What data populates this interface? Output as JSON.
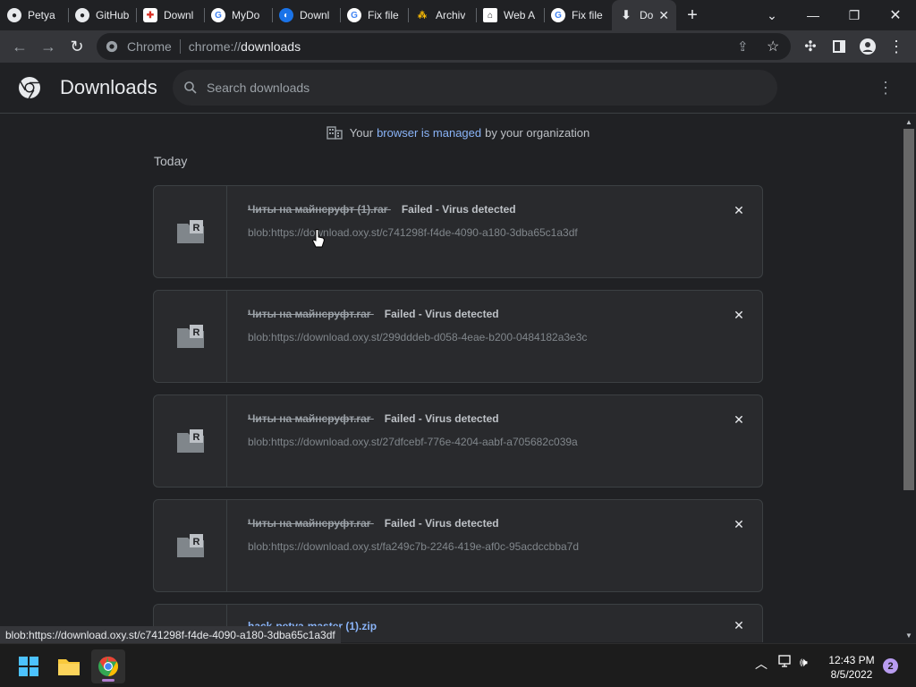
{
  "tabs": [
    {
      "label": "Petya",
      "icon": "github-icon",
      "active": false
    },
    {
      "label": "GitHub",
      "icon": "github-icon",
      "active": false
    },
    {
      "label": "Downl",
      "icon": "download-site-icon",
      "active": false
    },
    {
      "label": "MyDo",
      "icon": "google-icon",
      "active": false
    },
    {
      "label": "Downl",
      "icon": "download-site-icon",
      "active": false
    },
    {
      "label": "Fix file",
      "icon": "google-icon",
      "active": false
    },
    {
      "label": "Archiv",
      "icon": "archive-icon",
      "active": false
    },
    {
      "label": "Web A",
      "icon": "web-archive-icon",
      "active": false
    },
    {
      "label": "Fix file",
      "icon": "google-icon",
      "active": false
    },
    {
      "label": "Do",
      "icon": "download-icon",
      "active": true
    }
  ],
  "address": {
    "chip": "Chrome",
    "scheme": "chrome://",
    "host": "downloads"
  },
  "page": {
    "title": "Downloads",
    "search_placeholder": "Search downloads",
    "managed_prefix": "Your",
    "managed_link": "browser is managed",
    "managed_suffix": "by your organization",
    "section_today": "Today"
  },
  "downloads": [
    {
      "name": "Читы на майнсруфт (1).rar",
      "status": "Failed - Virus detected",
      "url": "blob:https://download.oxy.st/c741298f-f4de-4090-a180-3dba65c1a3df"
    },
    {
      "name": "Читы на майнсруфт.rar",
      "status": "Failed - Virus detected",
      "url": "blob:https://download.oxy.st/299dddeb-d058-4eae-b200-0484182a3e3c"
    },
    {
      "name": "Читы на майнсруфт.rar",
      "status": "Failed - Virus detected",
      "url": "blob:https://download.oxy.st/27dfcebf-776e-4204-aabf-a705682c039a"
    },
    {
      "name": "Читы на майнсруфт.rar",
      "status": "Failed - Virus detected",
      "url": "blob:https://download.oxy.st/fa249c7b-2246-419e-af0c-95acdccbba7d"
    },
    {
      "name": "hack-petya-master (1).zip"
    }
  ],
  "statusbar": {
    "text": "blob:https://download.oxy.st/c741298f-f4de-4090-a180-3dba65c1a3df"
  },
  "taskbar": {
    "time": "12:43 PM",
    "date": "8/5/2022",
    "notifications": "2"
  },
  "colors": {
    "accent": "#8ab4f8",
    "background": "#202124",
    "card": "#292a2d"
  }
}
